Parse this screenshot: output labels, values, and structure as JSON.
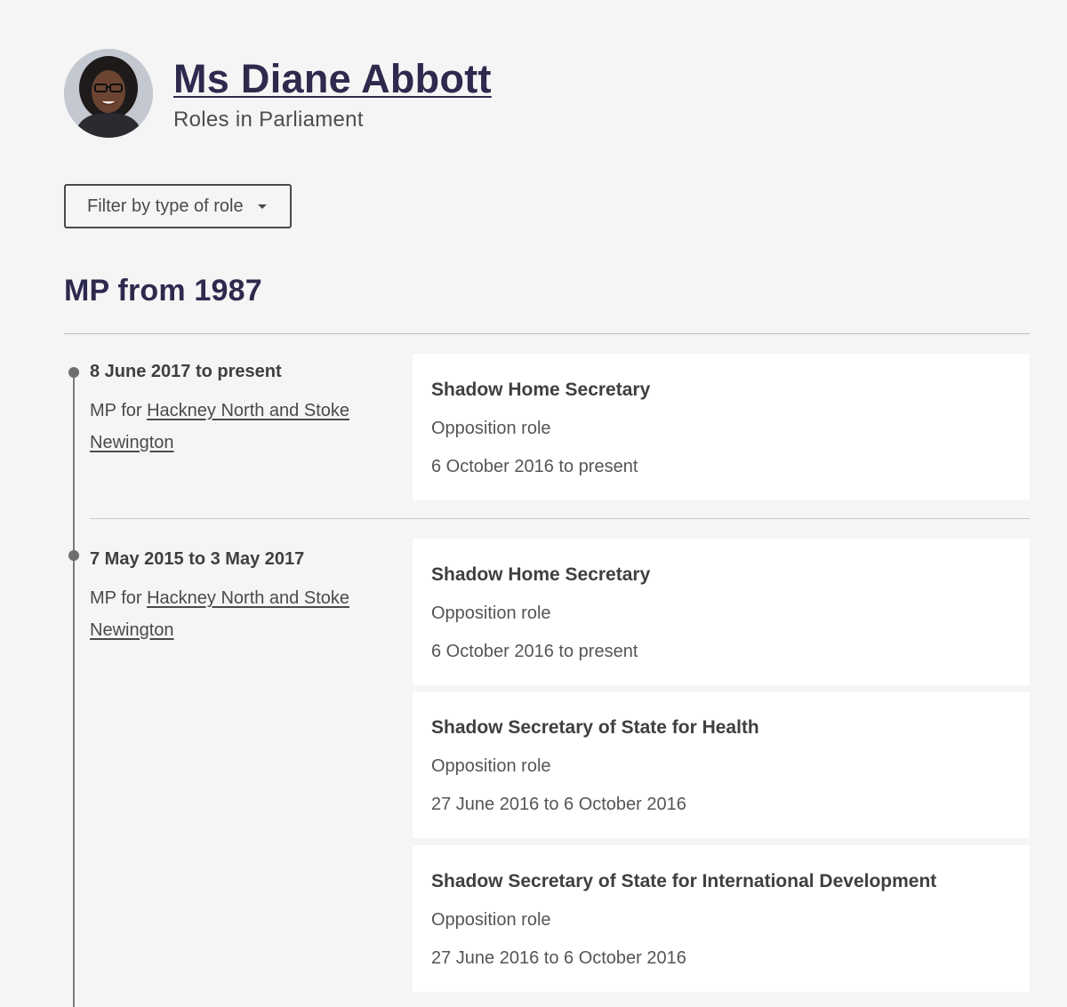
{
  "header": {
    "name": "Ms Diane Abbott",
    "subtitle": "Roles in Parliament"
  },
  "filter": {
    "label": "Filter by type of role"
  },
  "section": {
    "title": "MP from 1987"
  },
  "periods": [
    {
      "dates": "8 June 2017 to present",
      "seat_prefix": "MP for ",
      "constituency": "Hackney North and Stoke Newington",
      "roles": [
        {
          "title": "Shadow Home Secretary",
          "type": "Opposition role",
          "dates": "6 October 2016 to present"
        }
      ]
    },
    {
      "dates": "7 May 2015 to 3 May 2017",
      "seat_prefix": "MP for ",
      "constituency": "Hackney North and Stoke Newington",
      "roles": [
        {
          "title": "Shadow Home Secretary",
          "type": "Opposition role",
          "dates": "6 October 2016 to present"
        },
        {
          "title": "Shadow Secretary of State for Health",
          "type": "Opposition role",
          "dates": "27 June 2016 to 6 October 2016"
        },
        {
          "title": "Shadow Secretary of State for International Development",
          "type": "Opposition role",
          "dates": "27 June 2016 to 6 October 2016"
        }
      ]
    }
  ],
  "icons": {
    "filter_caret": "chevron-down-icon",
    "avatar": "portrait-photo"
  },
  "colors": {
    "heading": "#2d2a4e",
    "background": "#f5f5f5",
    "card": "#ffffff"
  }
}
